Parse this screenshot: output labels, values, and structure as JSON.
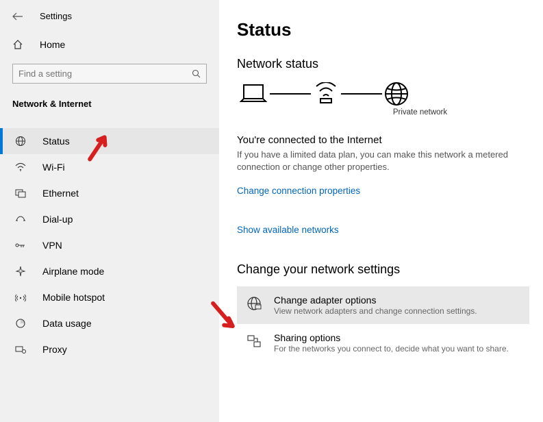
{
  "header": {
    "settings_label": "Settings"
  },
  "home_label": "Home",
  "search": {
    "placeholder": "Find a setting"
  },
  "category": "Network & Internet",
  "sidebar": {
    "items": [
      {
        "label": "Status"
      },
      {
        "label": "Wi-Fi"
      },
      {
        "label": "Ethernet"
      },
      {
        "label": "Dial-up"
      },
      {
        "label": "VPN"
      },
      {
        "label": "Airplane mode"
      },
      {
        "label": "Mobile hotspot"
      },
      {
        "label": "Data usage"
      },
      {
        "label": "Proxy"
      }
    ]
  },
  "main": {
    "title": "Status",
    "network_status_heading": "Network status",
    "diagram_caption": "Private network",
    "connected_heading": "You're connected to the Internet",
    "connected_desc": "If you have a limited data plan, you can make this network a metered connection or change other properties.",
    "link_change_connection": "Change connection properties",
    "link_show_networks": "Show available networks",
    "change_settings_heading": "Change your network settings",
    "settings_items": [
      {
        "title": "Change adapter options",
        "desc": "View network adapters and change connection settings."
      },
      {
        "title": "Sharing options",
        "desc": "For the networks you connect to, decide what you want to share."
      }
    ]
  }
}
